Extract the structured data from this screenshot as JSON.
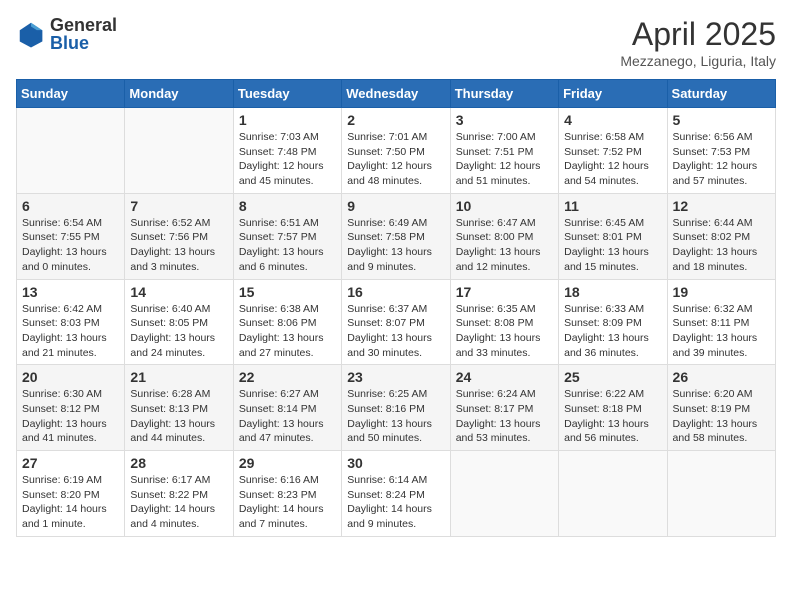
{
  "header": {
    "logo_general": "General",
    "logo_blue": "Blue",
    "month": "April 2025",
    "location": "Mezzanego, Liguria, Italy"
  },
  "weekdays": [
    "Sunday",
    "Monday",
    "Tuesday",
    "Wednesday",
    "Thursday",
    "Friday",
    "Saturday"
  ],
  "weeks": [
    [
      {
        "day": "",
        "info": ""
      },
      {
        "day": "",
        "info": ""
      },
      {
        "day": "1",
        "info": "Sunrise: 7:03 AM\nSunset: 7:48 PM\nDaylight: 12 hours\nand 45 minutes."
      },
      {
        "day": "2",
        "info": "Sunrise: 7:01 AM\nSunset: 7:50 PM\nDaylight: 12 hours\nand 48 minutes."
      },
      {
        "day": "3",
        "info": "Sunrise: 7:00 AM\nSunset: 7:51 PM\nDaylight: 12 hours\nand 51 minutes."
      },
      {
        "day": "4",
        "info": "Sunrise: 6:58 AM\nSunset: 7:52 PM\nDaylight: 12 hours\nand 54 minutes."
      },
      {
        "day": "5",
        "info": "Sunrise: 6:56 AM\nSunset: 7:53 PM\nDaylight: 12 hours\nand 57 minutes."
      }
    ],
    [
      {
        "day": "6",
        "info": "Sunrise: 6:54 AM\nSunset: 7:55 PM\nDaylight: 13 hours\nand 0 minutes."
      },
      {
        "day": "7",
        "info": "Sunrise: 6:52 AM\nSunset: 7:56 PM\nDaylight: 13 hours\nand 3 minutes."
      },
      {
        "day": "8",
        "info": "Sunrise: 6:51 AM\nSunset: 7:57 PM\nDaylight: 13 hours\nand 6 minutes."
      },
      {
        "day": "9",
        "info": "Sunrise: 6:49 AM\nSunset: 7:58 PM\nDaylight: 13 hours\nand 9 minutes."
      },
      {
        "day": "10",
        "info": "Sunrise: 6:47 AM\nSunset: 8:00 PM\nDaylight: 13 hours\nand 12 minutes."
      },
      {
        "day": "11",
        "info": "Sunrise: 6:45 AM\nSunset: 8:01 PM\nDaylight: 13 hours\nand 15 minutes."
      },
      {
        "day": "12",
        "info": "Sunrise: 6:44 AM\nSunset: 8:02 PM\nDaylight: 13 hours\nand 18 minutes."
      }
    ],
    [
      {
        "day": "13",
        "info": "Sunrise: 6:42 AM\nSunset: 8:03 PM\nDaylight: 13 hours\nand 21 minutes."
      },
      {
        "day": "14",
        "info": "Sunrise: 6:40 AM\nSunset: 8:05 PM\nDaylight: 13 hours\nand 24 minutes."
      },
      {
        "day": "15",
        "info": "Sunrise: 6:38 AM\nSunset: 8:06 PM\nDaylight: 13 hours\nand 27 minutes."
      },
      {
        "day": "16",
        "info": "Sunrise: 6:37 AM\nSunset: 8:07 PM\nDaylight: 13 hours\nand 30 minutes."
      },
      {
        "day": "17",
        "info": "Sunrise: 6:35 AM\nSunset: 8:08 PM\nDaylight: 13 hours\nand 33 minutes."
      },
      {
        "day": "18",
        "info": "Sunrise: 6:33 AM\nSunset: 8:09 PM\nDaylight: 13 hours\nand 36 minutes."
      },
      {
        "day": "19",
        "info": "Sunrise: 6:32 AM\nSunset: 8:11 PM\nDaylight: 13 hours\nand 39 minutes."
      }
    ],
    [
      {
        "day": "20",
        "info": "Sunrise: 6:30 AM\nSunset: 8:12 PM\nDaylight: 13 hours\nand 41 minutes."
      },
      {
        "day": "21",
        "info": "Sunrise: 6:28 AM\nSunset: 8:13 PM\nDaylight: 13 hours\nand 44 minutes."
      },
      {
        "day": "22",
        "info": "Sunrise: 6:27 AM\nSunset: 8:14 PM\nDaylight: 13 hours\nand 47 minutes."
      },
      {
        "day": "23",
        "info": "Sunrise: 6:25 AM\nSunset: 8:16 PM\nDaylight: 13 hours\nand 50 minutes."
      },
      {
        "day": "24",
        "info": "Sunrise: 6:24 AM\nSunset: 8:17 PM\nDaylight: 13 hours\nand 53 minutes."
      },
      {
        "day": "25",
        "info": "Sunrise: 6:22 AM\nSunset: 8:18 PM\nDaylight: 13 hours\nand 56 minutes."
      },
      {
        "day": "26",
        "info": "Sunrise: 6:20 AM\nSunset: 8:19 PM\nDaylight: 13 hours\nand 58 minutes."
      }
    ],
    [
      {
        "day": "27",
        "info": "Sunrise: 6:19 AM\nSunset: 8:20 PM\nDaylight: 14 hours\nand 1 minute."
      },
      {
        "day": "28",
        "info": "Sunrise: 6:17 AM\nSunset: 8:22 PM\nDaylight: 14 hours\nand 4 minutes."
      },
      {
        "day": "29",
        "info": "Sunrise: 6:16 AM\nSunset: 8:23 PM\nDaylight: 14 hours\nand 7 minutes."
      },
      {
        "day": "30",
        "info": "Sunrise: 6:14 AM\nSunset: 8:24 PM\nDaylight: 14 hours\nand 9 minutes."
      },
      {
        "day": "",
        "info": ""
      },
      {
        "day": "",
        "info": ""
      },
      {
        "day": "",
        "info": ""
      }
    ]
  ]
}
